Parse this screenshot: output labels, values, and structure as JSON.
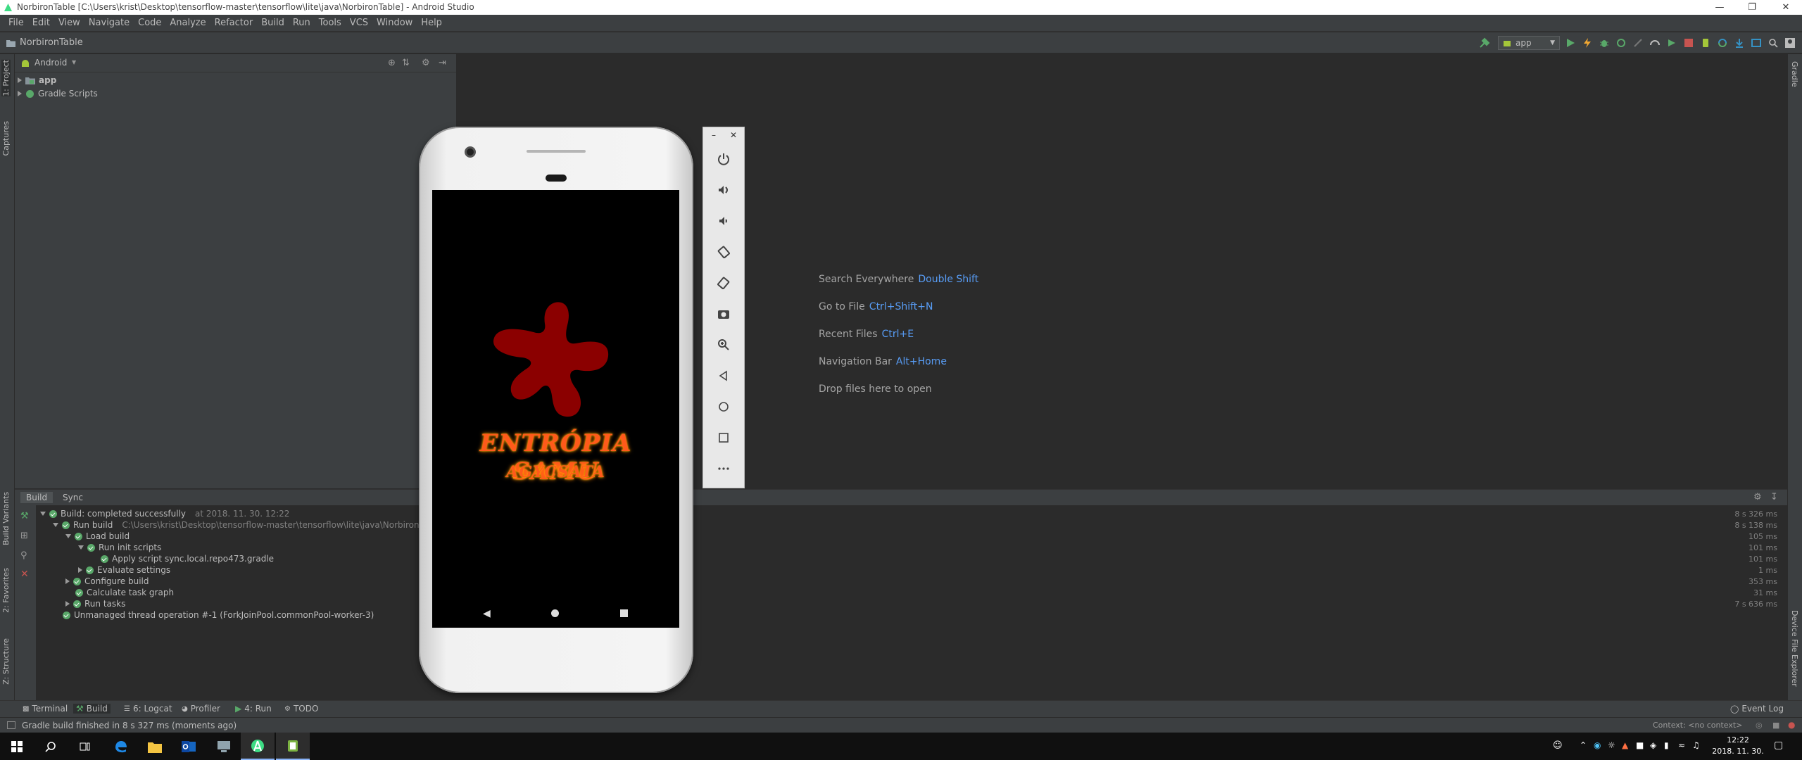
{
  "window": {
    "title": "NorbironTable [C:\\Users\\krist\\Desktop\\tensorflow-master\\tensorflow\\lite\\java\\NorbironTable] - Android Studio"
  },
  "menu": [
    "File",
    "Edit",
    "View",
    "Navigate",
    "Code",
    "Analyze",
    "Refactor",
    "Build",
    "Run",
    "Tools",
    "VCS",
    "Window",
    "Help"
  ],
  "navbar": {
    "breadcrumb": "NorbironTable",
    "run_config": "app"
  },
  "left_tabs": {
    "project": "1: Project",
    "captures": "Captures",
    "build_variants": "Build Variants",
    "favorites": "2: Favorites",
    "structure": "Z: Structure"
  },
  "right_tabs": {
    "gradle": "Gradle",
    "device_file_explorer": "Device File Explorer"
  },
  "project_panel": {
    "view_selector": "Android",
    "items": [
      {
        "label": "app"
      },
      {
        "label": "Gradle Scripts"
      }
    ]
  },
  "editor_hints": [
    {
      "text": "Search Everywhere",
      "key": "Double Shift"
    },
    {
      "text": "Go to File",
      "key": "Ctrl+Shift+N"
    },
    {
      "text": "Recent Files",
      "key": "Ctrl+E"
    },
    {
      "text": "Navigation Bar",
      "key": "Alt+Home"
    },
    {
      "text": "Drop files here to open",
      "key": ""
    }
  ],
  "emulator": {
    "app_title": "ENTRÓPIA SAMU",
    "app_subtitle": "AGYCSATA",
    "splash_color": "#8b0000",
    "controls": [
      "power-icon",
      "volume-up-icon",
      "volume-down-icon",
      "rotate-left-icon",
      "rotate-right-icon",
      "camera-icon",
      "zoom-icon",
      "back-icon",
      "home-icon",
      "overview-icon",
      "more-icon"
    ]
  },
  "build_panel": {
    "tabs": [
      "Build",
      "Sync"
    ],
    "lines": [
      {
        "text": "Build: completed successfully",
        "extra": "at 2018. 11. 30. 12:22",
        "time": "8 s 326 ms"
      },
      {
        "text": "Run build",
        "extra": "C:\\Users\\krist\\Desktop\\tensorflow-master\\tensorflow\\lite\\java\\NorbironTable",
        "time": "8 s 138 ms"
      },
      {
        "text": "Load build",
        "extra": "",
        "time": "105 ms"
      },
      {
        "text": "Run init scripts",
        "extra": "",
        "time": "101 ms"
      },
      {
        "text": "Apply script sync.local.repo473.gradle",
        "extra": "",
        "time": "101 ms"
      },
      {
        "text": "Evaluate settings",
        "extra": "",
        "time": "1 ms"
      },
      {
        "text": "Configure build",
        "extra": "",
        "time": "353 ms"
      },
      {
        "text": "Calculate task graph",
        "extra": "",
        "time": "31 ms"
      },
      {
        "text": "Run tasks",
        "extra": "",
        "time": "7 s 636 ms"
      },
      {
        "text": "Unmanaged thread operation #-1 (ForkJoinPool.commonPool-worker-3)",
        "extra": "",
        "time": ""
      }
    ]
  },
  "bottom_tabs": [
    "Terminal",
    "Build",
    "6: Logcat",
    "Profiler",
    "4: Run",
    "TODO"
  ],
  "event_log": "Event Log",
  "status": {
    "message": "Gradle build finished in 8 s 327 ms (moments ago)",
    "context": "Context: <no context>"
  },
  "taskbar": {
    "time": "12:22",
    "date": "2018. 11. 30."
  }
}
